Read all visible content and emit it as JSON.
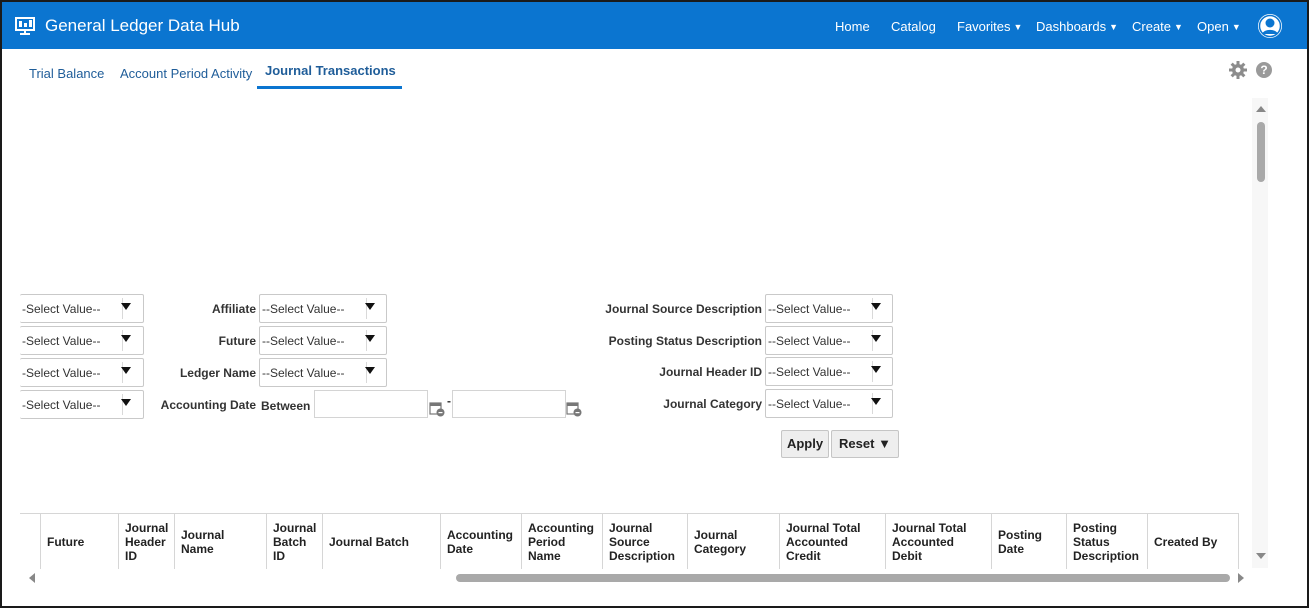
{
  "header": {
    "app_title": "General Ledger Data Hub",
    "nav": [
      {
        "label": "Home",
        "has_menu": false
      },
      {
        "label": "Catalog",
        "has_menu": false
      },
      {
        "label": "Favorites",
        "has_menu": true
      },
      {
        "label": "Dashboards",
        "has_menu": true
      },
      {
        "label": "Create",
        "has_menu": true
      },
      {
        "label": "Open",
        "has_menu": true
      }
    ],
    "caret": "▼",
    "brand_color": "#0b75d0"
  },
  "tabs": [
    {
      "label": "Trial Balance",
      "active": false
    },
    {
      "label": "Account Period Activity",
      "active": false
    },
    {
      "label": "Journal Transactions",
      "active": true
    }
  ],
  "toolbar_icons": {
    "settings": "gear-icon",
    "help": "?"
  },
  "prompts": {
    "select_placeholder": "--Select Value--",
    "left_column": [
      {
        "value": "-Select Value--"
      },
      {
        "value": "-Select Value--"
      },
      {
        "value": "-Select Value--"
      },
      {
        "value": "-Select Value--"
      }
    ],
    "middle_column": [
      {
        "label": "Affiliate",
        "value": "--Select Value--"
      },
      {
        "label": "Future",
        "value": "--Select Value--"
      },
      {
        "label": "Ledger Name",
        "value": "--Select Value--"
      }
    ],
    "accounting_date": {
      "label": "Accounting Date",
      "operator": "Between",
      "from": "",
      "to": "",
      "separator": "-"
    },
    "right_column": [
      {
        "label": "Journal Source Description",
        "value": "--Select Value--"
      },
      {
        "label": "Posting Status Description",
        "value": "--Select Value--"
      },
      {
        "label": "Journal Header ID",
        "value": "--Select Value--"
      },
      {
        "label": "Journal Category",
        "value": "--Select Value--"
      }
    ],
    "apply_label": "Apply",
    "reset_label": "Reset ▼"
  },
  "table": {
    "columns": [
      "",
      "Future",
      "Journal Header ID",
      "Journal Name",
      "Journal Batch ID",
      "Journal Batch",
      "Accounting Date",
      "Accounting Period Name",
      "Journal Source Description",
      "Journal Category",
      "Journal Total Accounted Credit",
      "Journal Total Accounted Debit",
      "Posting Date",
      "Posting Status Description",
      "Created By"
    ]
  }
}
